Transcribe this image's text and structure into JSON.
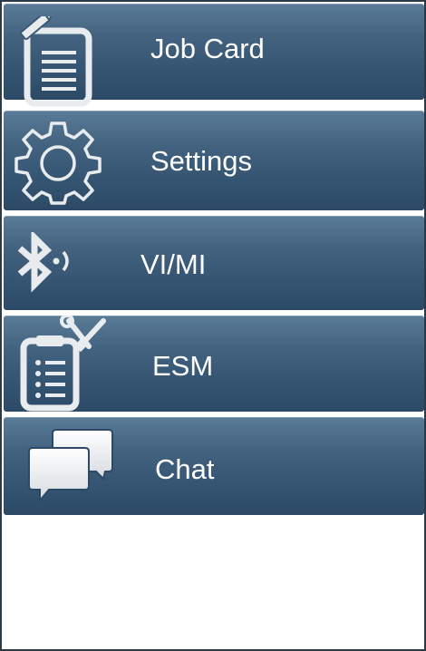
{
  "menu": {
    "items": [
      {
        "label": "Job Card",
        "icon": "job-card-icon"
      },
      {
        "label": "Settings",
        "icon": "gear-icon"
      },
      {
        "label": "VI/MI",
        "icon": "bluetooth-icon"
      },
      {
        "label": "ESM",
        "icon": "clipboard-tools-icon"
      },
      {
        "label": "Chat",
        "icon": "chat-bubbles-icon"
      }
    ]
  },
  "colors": {
    "item_top": "#5b7c98",
    "item_bottom": "#2c4a66",
    "icon_fill": "#e9ecef",
    "text": "#ffffff"
  }
}
